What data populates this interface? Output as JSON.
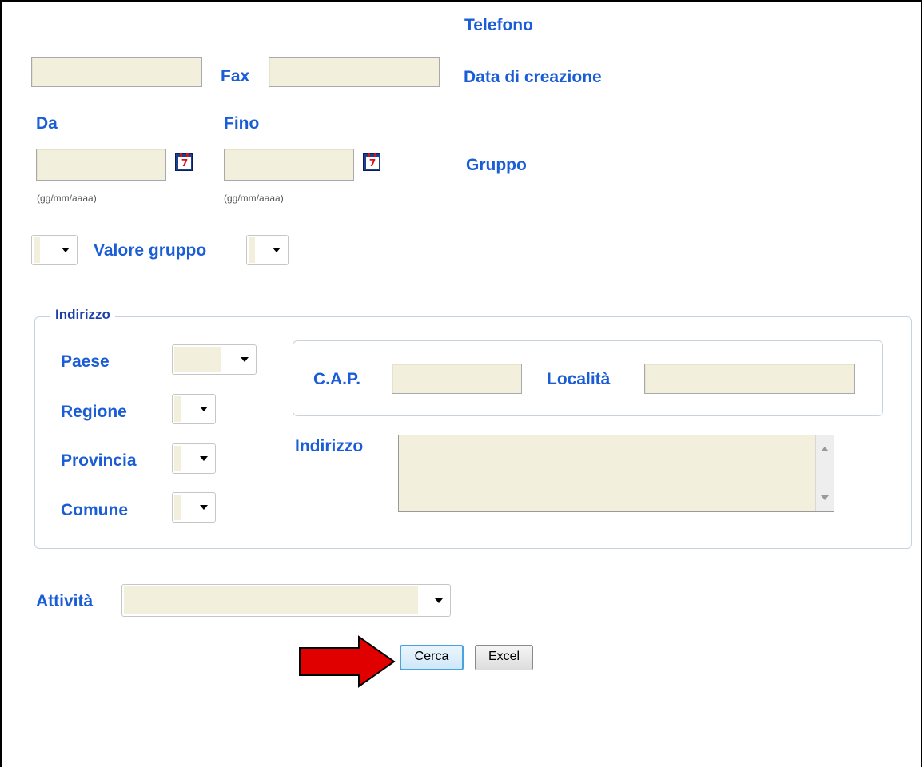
{
  "labels": {
    "telefono": "Telefono",
    "fax": "Fax",
    "data_creazione": "Data di creazione",
    "da": "Da",
    "fino": "Fino",
    "gruppo": "Gruppo",
    "valore_gruppo": "Valore gruppo",
    "date_format": "(gg/mm/aaaa)",
    "attivita": "Attività"
  },
  "calendar_icon_text": "7",
  "indirizzo_group": {
    "legend": "Indirizzo",
    "paese": "Paese",
    "regione": "Regione",
    "provincia": "Provincia",
    "comune": "Comune",
    "cap": "C.A.P.",
    "localita": "Località",
    "indirizzo": "Indirizzo"
  },
  "buttons": {
    "cerca": "Cerca",
    "excel": "Excel"
  },
  "colors": {
    "label_blue": "#1a5dd6",
    "input_bg": "#f2f0dc",
    "arrow_red": "#e00000"
  },
  "icons": [
    "calendar-icon",
    "dropdown-arrow-icon",
    "red-arrow-icon"
  ]
}
